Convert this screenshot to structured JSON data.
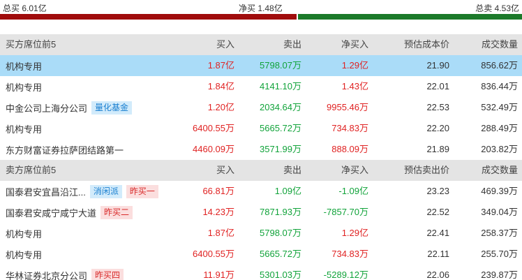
{
  "summary": {
    "buy_total": "总买 6.01亿",
    "net_buy": "净买 1.48亿",
    "sell_total": "总卖 4.53亿",
    "buy_fraction": 0.57,
    "buy_color": "#a00c0c",
    "sell_color": "#1c7a2a"
  },
  "colors": {
    "red": "#e02222",
    "green": "#11a33a",
    "neutral": "#333333"
  },
  "buy_section": {
    "headers": [
      "买方席位前5",
      "买入",
      "卖出",
      "净买入",
      "预估成本价",
      "成交数量"
    ],
    "rows": [
      {
        "name": "机构专用",
        "tags": [],
        "buy": "1.87亿",
        "sell": "5798.07万",
        "net": "1.29亿",
        "price": "21.90",
        "volume": "856.62万",
        "selected": true
      },
      {
        "name": "机构专用",
        "tags": [],
        "buy": "1.84亿",
        "sell": "4141.10万",
        "net": "1.43亿",
        "price": "22.01",
        "volume": "836.44万"
      },
      {
        "name": "中金公司上海分公司",
        "tags": [
          {
            "text": "量化基金",
            "style": "blue"
          }
        ],
        "buy": "1.20亿",
        "sell": "2034.64万",
        "net": "9955.46万",
        "price": "22.53",
        "volume": "532.49万"
      },
      {
        "name": "机构专用",
        "tags": [],
        "buy": "6400.55万",
        "sell": "5665.72万",
        "net": "734.83万",
        "price": "22.20",
        "volume": "288.49万"
      },
      {
        "name": "东方财富证券拉萨团结路第一",
        "tags": [],
        "buy": "4460.09万",
        "sell": "3571.99万",
        "net": "888.09万",
        "price": "21.89",
        "volume": "203.82万"
      }
    ]
  },
  "sell_section": {
    "headers": [
      "卖方席位前5",
      "买入",
      "卖出",
      "净买入",
      "预估卖出价",
      "成交数量"
    ],
    "rows": [
      {
        "name": "国泰君安宜昌沿江...",
        "tags": [
          {
            "text": "消闲派",
            "style": "blue"
          },
          {
            "text": "昨买一",
            "style": "red"
          }
        ],
        "buy": "66.81万",
        "sell": "1.09亿",
        "net": "-1.09亿",
        "price": "23.23",
        "volume": "469.39万"
      },
      {
        "name": "国泰君安咸宁咸宁大道",
        "tags": [
          {
            "text": "昨买二",
            "style": "red"
          }
        ],
        "buy": "14.23万",
        "sell": "7871.93万",
        "net": "-7857.70万",
        "price": "22.52",
        "volume": "349.04万"
      },
      {
        "name": "机构专用",
        "tags": [],
        "buy": "1.87亿",
        "sell": "5798.07万",
        "net": "1.29亿",
        "price": "22.41",
        "volume": "258.37万"
      },
      {
        "name": "机构专用",
        "tags": [],
        "buy": "6400.55万",
        "sell": "5665.72万",
        "net": "734.83万",
        "price": "22.11",
        "volume": "255.70万"
      },
      {
        "name": "华林证券北京分公司",
        "tags": [
          {
            "text": "昨买四",
            "style": "red"
          }
        ],
        "buy": "11.91万",
        "sell": "5301.03万",
        "net": "-5289.12万",
        "price": "22.06",
        "volume": "239.87万"
      }
    ]
  }
}
